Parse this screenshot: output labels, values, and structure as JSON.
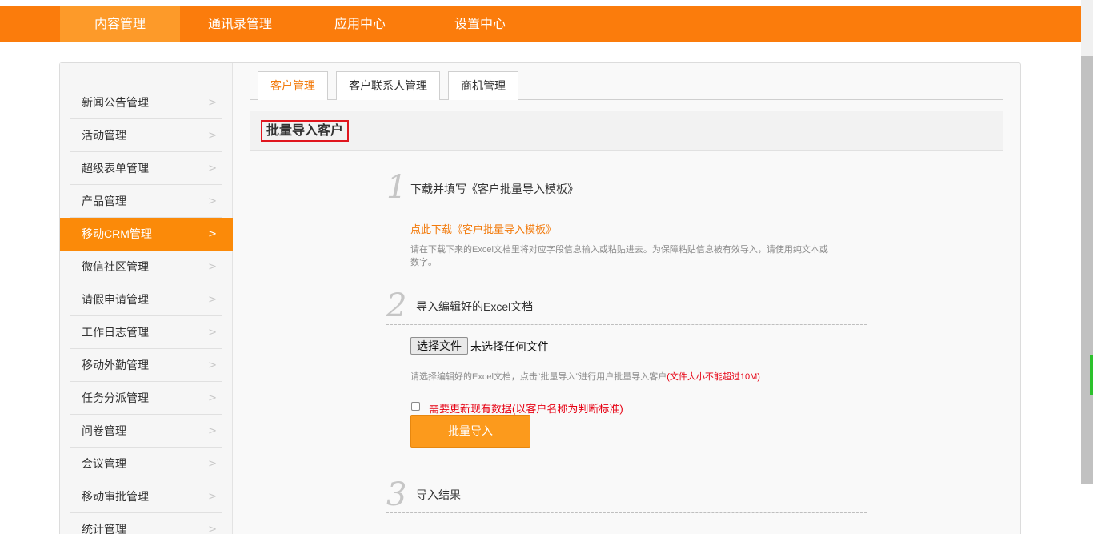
{
  "topnav": [
    "内容管理",
    "通讯录管理",
    "应用中心",
    "设置中心"
  ],
  "sidebar": [
    "新闻公告管理",
    "活动管理",
    "超级表单管理",
    "产品管理",
    "移动CRM管理",
    "微信社区管理",
    "请假申请管理",
    "工作日志管理",
    "移动外勤管理",
    "任务分派管理",
    "问卷管理",
    "会议管理",
    "移动审批管理",
    "统计管理"
  ],
  "sidebar_active_index": 4,
  "sidebar_arrow": ">",
  "tabs": [
    "客户管理",
    "客户联系人管理",
    "商机管理"
  ],
  "section_title": "批量导入客户",
  "steps": [
    {
      "num": "1",
      "title": "下载并填写《客户批量导入模板》"
    },
    {
      "num": "2",
      "title": "导入编辑好的Excel文档"
    },
    {
      "num": "3",
      "title": "导入结果"
    }
  ],
  "download_link": "点此下载《客户批量导入模板》",
  "step1_hint_line1": "请在下载下来的Excel文档里将对应字段信息输入或粘贴进去。为保障粘贴信息被有效导入，请使用纯文本或",
  "step1_hint_line2": "数字。",
  "file_button": "选择文件",
  "file_status": "未选择任何文件",
  "step2_hint": "请选择编辑好的Excel文档，点击“批量导入”进行用户批量导入客户",
  "step2_hint_red": "(文件大小不能超过10M)",
  "update_checkbox_label": "需要更新现有数据(以客户名称为判断标准)",
  "import_button": "批量导入",
  "colors": {
    "accent": "#fb7c0c",
    "active_nav": "#fd9a29",
    "active_side": "#fb8a09",
    "warning": "#e60012"
  }
}
